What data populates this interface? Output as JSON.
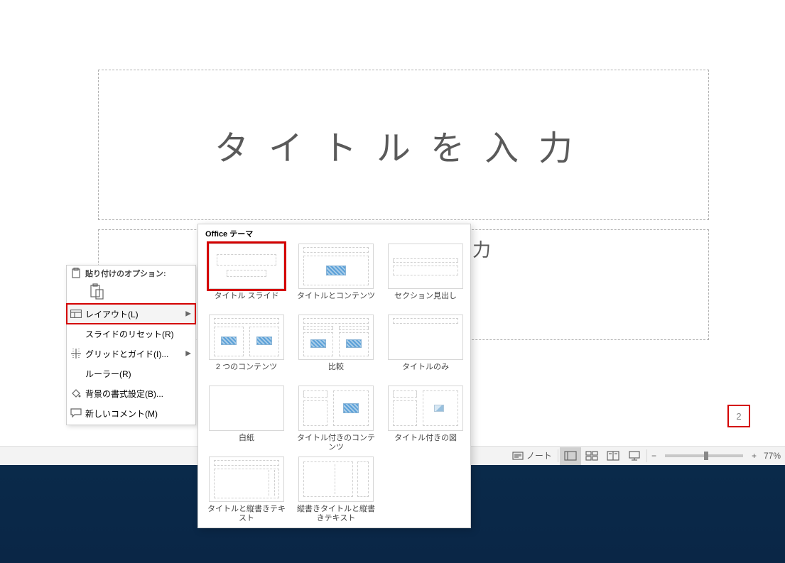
{
  "slide": {
    "title_placeholder": "タイトルを入力"
  },
  "page_number": "2",
  "context_menu": {
    "paste_options_label": "貼り付けのオプション:",
    "layout": "レイアウト(L)",
    "reset": "スライドのリセット(R)",
    "grid_guide": "グリッドとガイド(I)...",
    "ruler": "ルーラー(R)",
    "background": "背景の書式設定(B)...",
    "new_comment": "新しいコメント(M)"
  },
  "gallery": {
    "title": "Office テーマ",
    "items": [
      {
        "id": "title-slide",
        "label": "タイトル スライド",
        "selected": true
      },
      {
        "id": "title-content",
        "label": "タイトルとコンテンツ"
      },
      {
        "id": "section-header",
        "label": "セクション見出し"
      },
      {
        "id": "two-content",
        "label": "2 つのコンテンツ"
      },
      {
        "id": "comparison",
        "label": "比較"
      },
      {
        "id": "title-only",
        "label": "タイトルのみ"
      },
      {
        "id": "blank",
        "label": "白紙"
      },
      {
        "id": "content-caption",
        "label": "タイトル付きのコンテンツ"
      },
      {
        "id": "picture-caption",
        "label": "タイトル付きの図"
      },
      {
        "id": "title-vertical-text",
        "label": "タイトルと縦書きテキスト"
      },
      {
        "id": "vertical-title-text",
        "label": "縦書きタイトルと縦書きテキスト"
      }
    ]
  },
  "statusbar": {
    "notes": "ノート",
    "zoom": "77%"
  },
  "cut_char": "力"
}
